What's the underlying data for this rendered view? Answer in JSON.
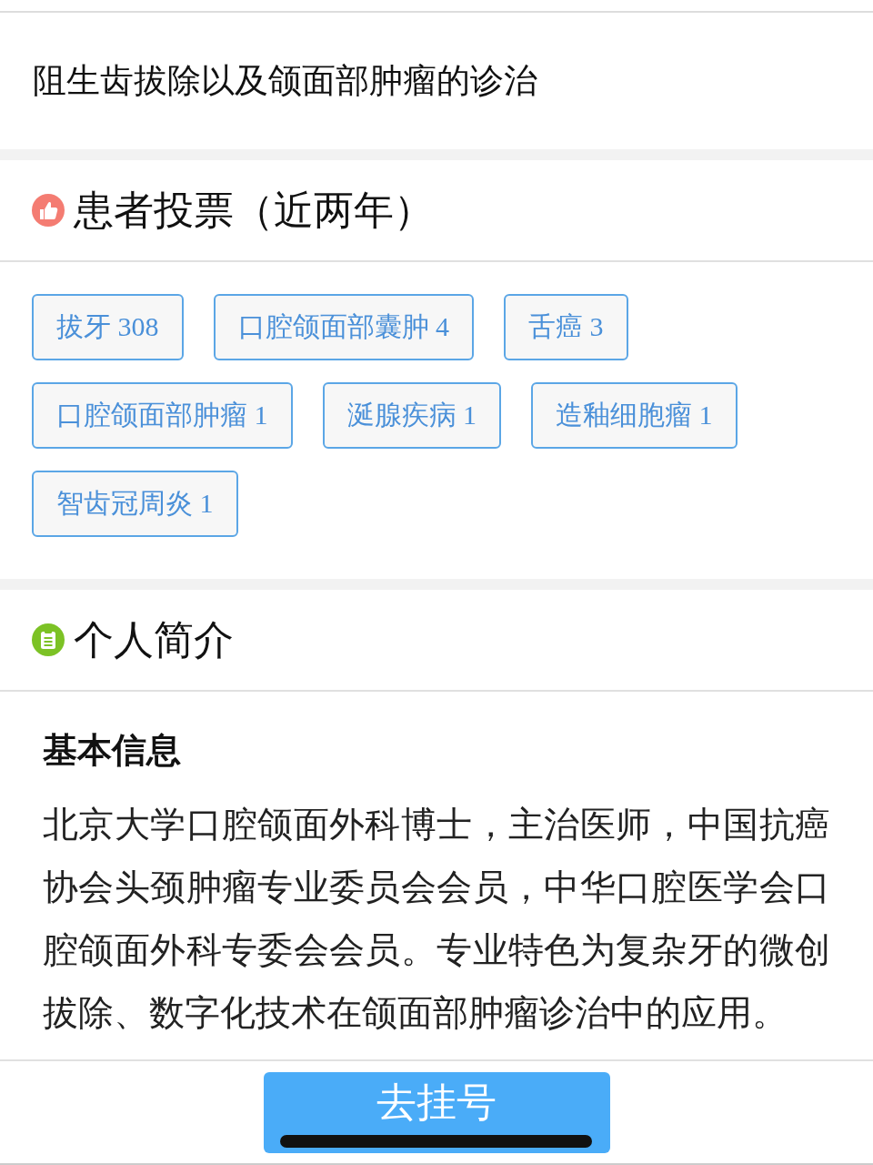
{
  "specialty": {
    "text": "阻生齿拔除以及颌面部肿瘤的诊治"
  },
  "votes": {
    "title": "患者投票（近两年）",
    "tags": [
      {
        "label": "拔牙 308"
      },
      {
        "label": "口腔颌面部囊肿 4"
      },
      {
        "label": "舌癌 3"
      },
      {
        "label": "口腔颌面部肿瘤 1"
      },
      {
        "label": "涎腺疾病 1"
      },
      {
        "label": "造釉细胞瘤 1"
      },
      {
        "label": "智齿冠周炎 1"
      }
    ]
  },
  "profile": {
    "title": "个人简介",
    "subtitle": "基本信息",
    "text": "北京大学口腔颌面外科博士，主治医师，中国抗癌协会头颈肿瘤专业委员会会员，中华口腔医学会口腔颌面外科专委会会员。专业特色为复杂牙的微创拔除、数字化技术在颌面部肿瘤诊治中的应用。"
  },
  "bottom_bar": {
    "button": "去挂号"
  }
}
